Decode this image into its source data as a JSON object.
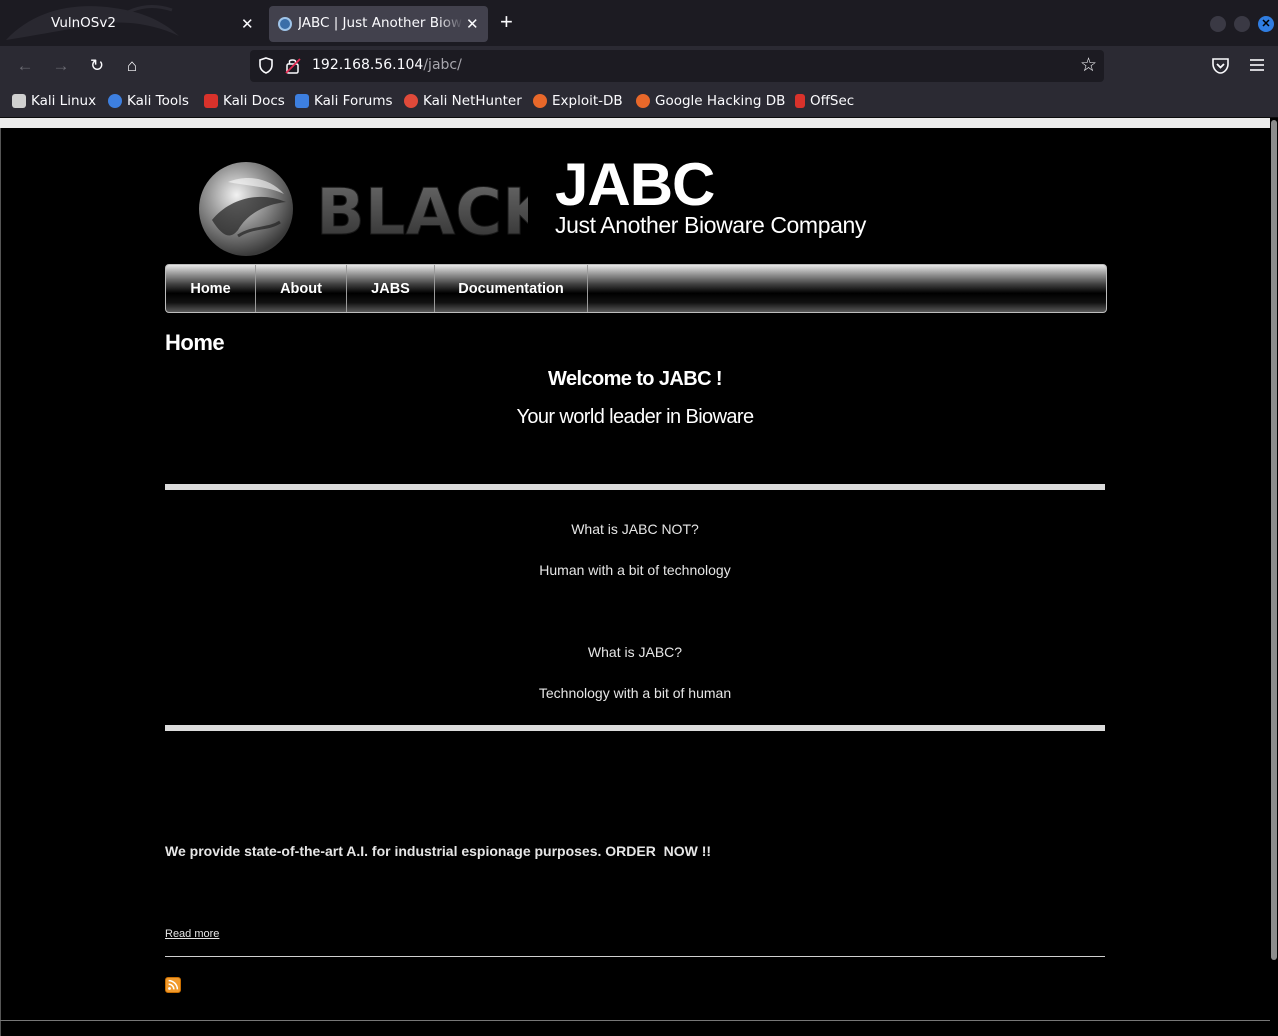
{
  "browser": {
    "tabs": [
      {
        "label": "VulnOSv2",
        "active": false
      },
      {
        "label": "JABC | Just Another Bioware Company",
        "active": true
      }
    ],
    "url": {
      "host": "192.168.56.104",
      "path": "/jabc/"
    },
    "bookmarks": [
      {
        "label": "Kali Linux",
        "icon": "kali-dragon-icon",
        "color": "#cfcfcf"
      },
      {
        "label": "Kali Tools",
        "icon": "kali-tools-icon",
        "color": "#3d7fe0"
      },
      {
        "label": "Kali Docs",
        "icon": "kali-docs-icon",
        "color": "#d9322b"
      },
      {
        "label": "Kali Forums",
        "icon": "kali-forums-icon",
        "color": "#3d7fe0"
      },
      {
        "label": "Kali NetHunter",
        "icon": "kali-nethunter-icon",
        "color": "#e04a3a"
      },
      {
        "label": "Exploit-DB",
        "icon": "exploit-db-icon",
        "color": "#e8682a"
      },
      {
        "label": "Google Hacking DB",
        "icon": "ghdb-icon",
        "color": "#e8682a"
      },
      {
        "label": "OffSec",
        "icon": "offsec-icon",
        "color": "#d9322b"
      }
    ]
  },
  "site": {
    "logo_text": "BLACK",
    "name": "JABC",
    "slogan": "Just Another Bioware Company"
  },
  "menu": [
    {
      "label": "Home"
    },
    {
      "label": "About"
    },
    {
      "label": "JABS"
    },
    {
      "label": "Documentation"
    }
  ],
  "content": {
    "page_title": "Home",
    "welcome": "Welcome to JABC !",
    "tagline": "Your world leader in Bioware",
    "q1": "What is JABC NOT?",
    "a1": "Human with a bit of technology",
    "q2": "What is JABC?",
    "a2": "Technology with a bit of human",
    "promo": "We provide state-of-the-art A.I. for industrial espionage purposes. ORDER  NOW !!",
    "read_more": "Read more"
  },
  "colors": {
    "chrome_dark": "#1c1b22",
    "chrome": "#2b2a33",
    "active_tab": "#42414d",
    "page_bg": "#000000",
    "accent_close": "#2f7de1",
    "rss": "#f19a2c"
  }
}
